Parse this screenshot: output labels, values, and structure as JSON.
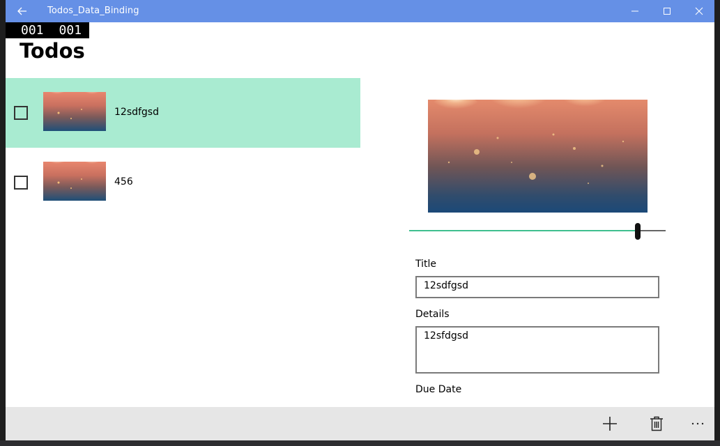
{
  "window": {
    "title": "Todos_Data_Binding",
    "titlebar_color": "#6590e6"
  },
  "frame_counter": [
    "001",
    "001"
  ],
  "page": {
    "title": "Todos"
  },
  "todos": [
    {
      "label": "12sdfgsd",
      "checked": false,
      "selected": true
    },
    {
      "label": "456",
      "checked": false,
      "selected": false
    }
  ],
  "selection_color": "#a9ebd1",
  "detail": {
    "slider_value_percent": 89,
    "title_label": "Title",
    "title_value": "12sdfgsd",
    "details_label": "Details",
    "details_value": "12sfdgsd",
    "due_date_label": "Due Date"
  },
  "appbar": {
    "buttons": [
      "add-icon",
      "delete-icon",
      "more-icon"
    ]
  }
}
